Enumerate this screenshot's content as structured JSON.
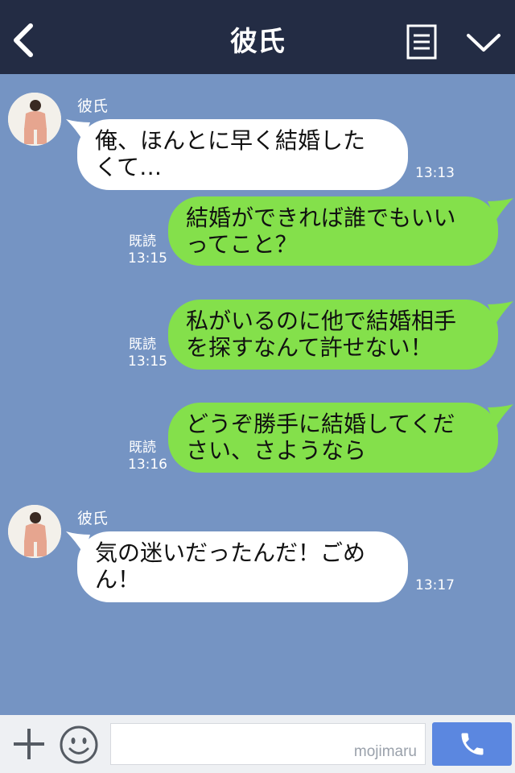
{
  "header": {
    "title": "彼氏",
    "back_icon": "chevron-left-icon",
    "menu_icon": "menu-icon",
    "dropdown_icon": "chevron-down-icon"
  },
  "messages": [
    {
      "sender": "彼氏",
      "text": "俺、ほんとに早く結婚した\nくて…",
      "time": "13:13"
    },
    {
      "text": "結婚ができれば誰でもいい\nってこと？",
      "read": "既読",
      "time": "13:15"
    },
    {
      "text": "私がいるのに他で結婚相手\nを探すなんて許せない！",
      "read": "既読",
      "time": "13:15"
    },
    {
      "text": "どうぞ勝手に結婚してくだ\nさい、さようなら",
      "read": "既読",
      "time": "13:16"
    },
    {
      "sender": "彼氏",
      "text": "気の迷いだったんだ！ごめ\nん！",
      "time": "13:17"
    }
  ],
  "footer": {
    "plus_icon": "plus-icon",
    "emoji_icon": "smiley-icon",
    "input_value": "",
    "watermark": "mojimaru",
    "call_icon": "phone-icon"
  },
  "colors": {
    "header_bg": "#232c44",
    "chat_bg": "#7594c3",
    "incoming_bubble": "#ffffff",
    "outgoing_bubble": "#84e04b",
    "call_button": "#5b87e0"
  }
}
